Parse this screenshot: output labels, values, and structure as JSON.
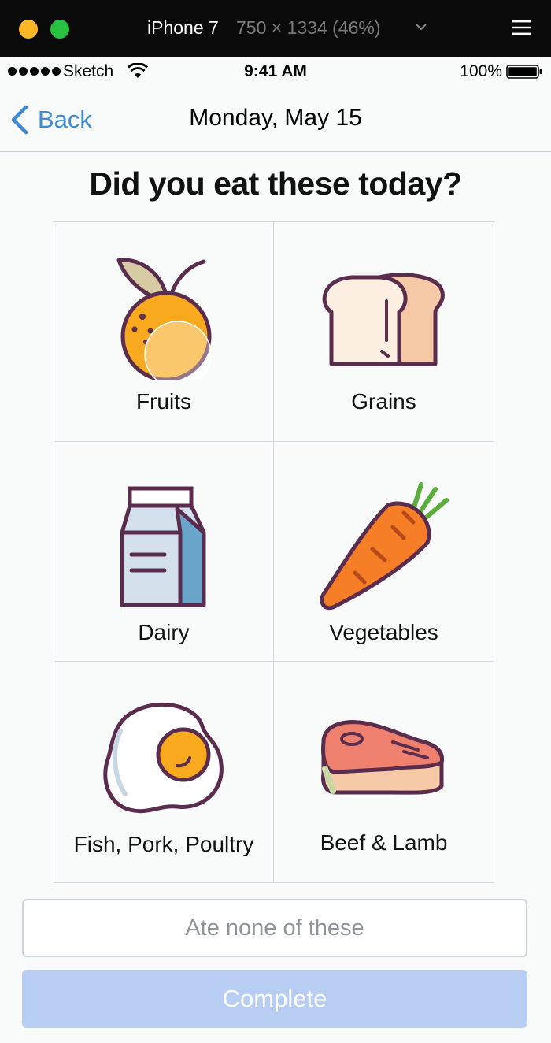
{
  "simulator": {
    "device": "iPhone 7",
    "size": "750 × 1334 (46%)",
    "icons": [
      "close-button",
      "zoom-button",
      "chevron-down-icon",
      "menu-icon"
    ]
  },
  "status_bar": {
    "carrier": "Sketch",
    "time": "9:41 AM",
    "battery": "100%"
  },
  "nav": {
    "back_label": "Back",
    "title": "Monday, May 15"
  },
  "question": "Did you eat these today?",
  "categories": [
    {
      "label": "Fruits",
      "icon": "orange-icon"
    },
    {
      "label": "Grains",
      "icon": "bread-icon"
    },
    {
      "label": "Dairy",
      "icon": "milk-carton-icon"
    },
    {
      "label": "Vegetables",
      "icon": "carrot-icon"
    },
    {
      "label": "Fish, Pork, Poultry",
      "icon": "fried-egg-icon"
    },
    {
      "label": "Beef & Lamb",
      "icon": "steak-icon"
    }
  ],
  "buttons": {
    "none_label": "Ate none of these",
    "complete_label": "Complete"
  },
  "colors": {
    "accent": "#3d8ad1",
    "complete_disabled": "#b7cdf1",
    "icon_outline": "#5a2d4f"
  }
}
